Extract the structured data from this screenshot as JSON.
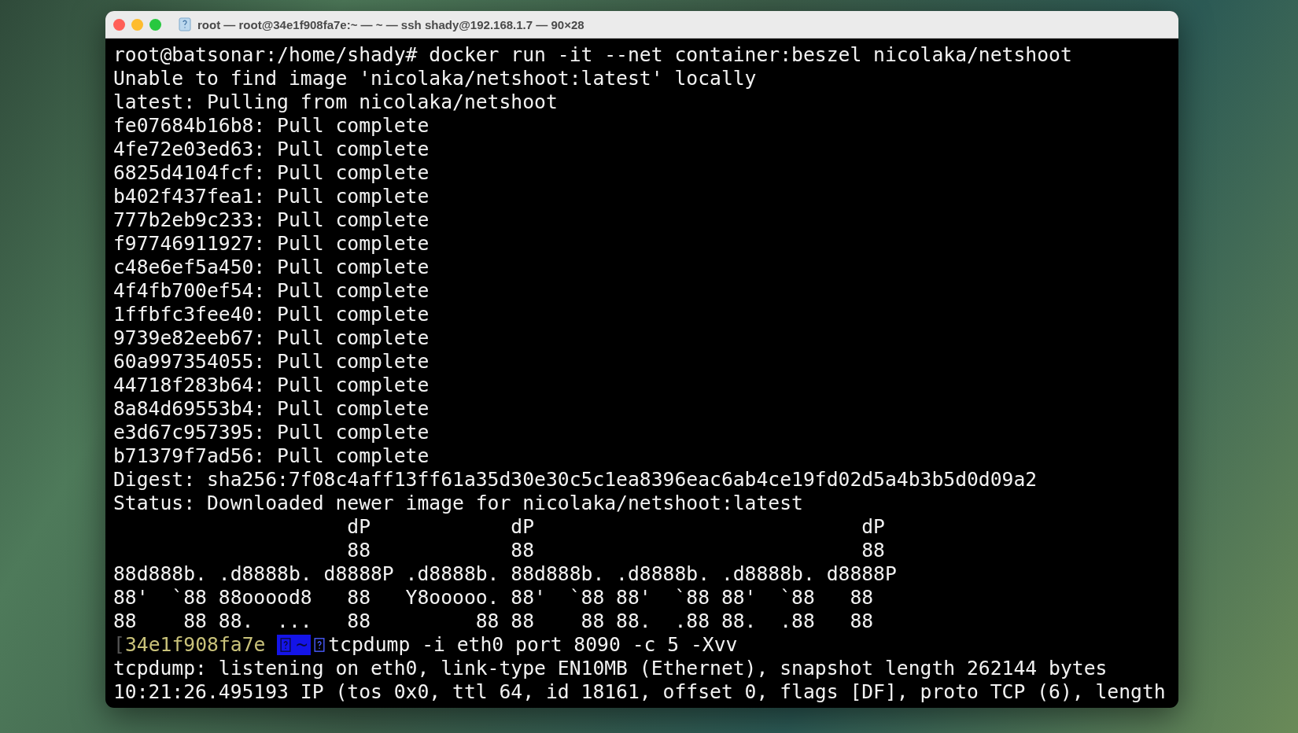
{
  "window": {
    "title": "root — root@34e1f908fa7e:~ — ~ — ssh shady@192.168.1.7 — 90×28"
  },
  "terminal": {
    "lines": [
      {
        "kind": "text",
        "text": "root@batsonar:/home/shady# docker run -it --net container:beszel nicolaka/netshoot"
      },
      {
        "kind": "text",
        "text": "Unable to find image 'nicolaka/netshoot:latest' locally"
      },
      {
        "kind": "text",
        "text": "latest: Pulling from nicolaka/netshoot"
      },
      {
        "kind": "text",
        "text": "fe07684b16b8: Pull complete"
      },
      {
        "kind": "text",
        "text": "4fe72e03ed63: Pull complete"
      },
      {
        "kind": "text",
        "text": "6825d4104fcf: Pull complete"
      },
      {
        "kind": "text",
        "text": "b402f437fea1: Pull complete"
      },
      {
        "kind": "text",
        "text": "777b2eb9c233: Pull complete"
      },
      {
        "kind": "text",
        "text": "f97746911927: Pull complete"
      },
      {
        "kind": "text",
        "text": "c48e6ef5a450: Pull complete"
      },
      {
        "kind": "text",
        "text": "4f4fb700ef54: Pull complete"
      },
      {
        "kind": "text",
        "text": "1ffbfc3fee40: Pull complete"
      },
      {
        "kind": "text",
        "text": "9739e82eeb67: Pull complete"
      },
      {
        "kind": "text",
        "text": "60a997354055: Pull complete"
      },
      {
        "kind": "text",
        "text": "44718f283b64: Pull complete"
      },
      {
        "kind": "text",
        "text": "8a84d69553b4: Pull complete"
      },
      {
        "kind": "text",
        "text": "e3d67c957395: Pull complete"
      },
      {
        "kind": "text",
        "text": "b71379f7ad56: Pull complete"
      },
      {
        "kind": "text",
        "text": "Digest: sha256:7f08c4aff13ff61a35d30e30c5c1ea8396eac6ab4ce19fd02d5a4b3b5d0d09a2"
      },
      {
        "kind": "text",
        "text": "Status: Downloaded newer image for nicolaka/netshoot:latest"
      },
      {
        "kind": "text",
        "text": "                    dP            dP                            dP"
      },
      {
        "kind": "text",
        "text": "                    88            88                            88"
      },
      {
        "kind": "text",
        "text": "88d888b. .d8888b. d8888P .d8888b. 88d888b. .d8888b. .d8888b. d8888P"
      },
      {
        "kind": "text",
        "text": "88'  `88 88ooood8   88   Y8ooooo. 88'  `88 88'  `88 88'  `88   88"
      },
      {
        "kind": "text",
        "text": "88    88 88.  ...   88         88 88    88 88.  .88 88.  .88   88"
      },
      {
        "kind": "prompt",
        "bracket": "[",
        "host": "34e1f908fa7e",
        "dir": "~",
        "command": "tcpdump -i eth0 port 8090 -c 5 -Xvv"
      },
      {
        "kind": "text",
        "text": "tcpdump: listening on eth0, link-type EN10MB (Ethernet), snapshot length 262144 bytes"
      },
      {
        "kind": "text",
        "text": "10:21:26.495193 IP (tos 0x0, ttl 64, id 18161, offset 0, flags [DF], proto TCP (6), length"
      }
    ]
  }
}
